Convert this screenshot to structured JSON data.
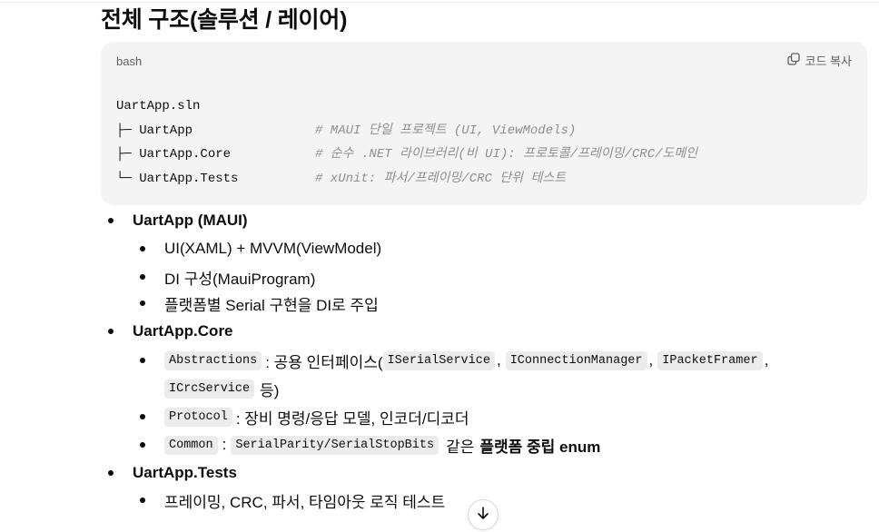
{
  "heading": "전체 구조(솔루션 / 레이어)",
  "code_block": {
    "language": "bash",
    "copy_label": "코드 복사",
    "lines": [
      {
        "left": "UartApp.sln",
        "comment": ""
      },
      {
        "left": "├─ UartApp",
        "comment": "# MAUI 단일 프로젝트 (UI, ViewModels)"
      },
      {
        "left": "├─ UartApp.Core",
        "comment": "# 순수 .NET 라이브러리(비 UI): 프로토콜/프레이밍/CRC/도메인"
      },
      {
        "left": "└─ UartApp.Tests",
        "comment": "# xUnit: 파서/프레이밍/CRC 단위 테스트"
      }
    ]
  },
  "list": {
    "app": {
      "title": "UartApp (MAUI)",
      "items": [
        "UI(XAML) + MVVM(ViewModel)",
        "DI 구성(MauiProgram)",
        "플랫폼별 Serial 구현을 DI로 주입"
      ]
    },
    "core": {
      "title": "UartApp.Core",
      "abstractions": {
        "code": "Abstractions",
        "text_before": ": 공용 인터페이스(",
        "iface1": "ISerialService",
        "sep1": ",",
        "iface2": "IConnectionManager",
        "sep2": ",",
        "iface3": "IPacketFramer",
        "sep3": ",",
        "iface4": "ICrcService",
        "text_after": "등)"
      },
      "protocol": {
        "code": "Protocol",
        "text": ": 장비 명령/응답 모델, 인코더/디코더"
      },
      "common": {
        "code": "Common",
        "colon": ":",
        "code2": "SerialParity/SerialStopBits",
        "text": "같은",
        "bold": "플랫폼 중립 enum"
      }
    },
    "tests": {
      "title": "UartApp.Tests",
      "items": [
        "프레이밍, CRC, 파서, 타임아웃 로직 테스트"
      ]
    }
  },
  "icons": {
    "copy": "copy-icon",
    "scroll": "arrow-down-icon"
  }
}
